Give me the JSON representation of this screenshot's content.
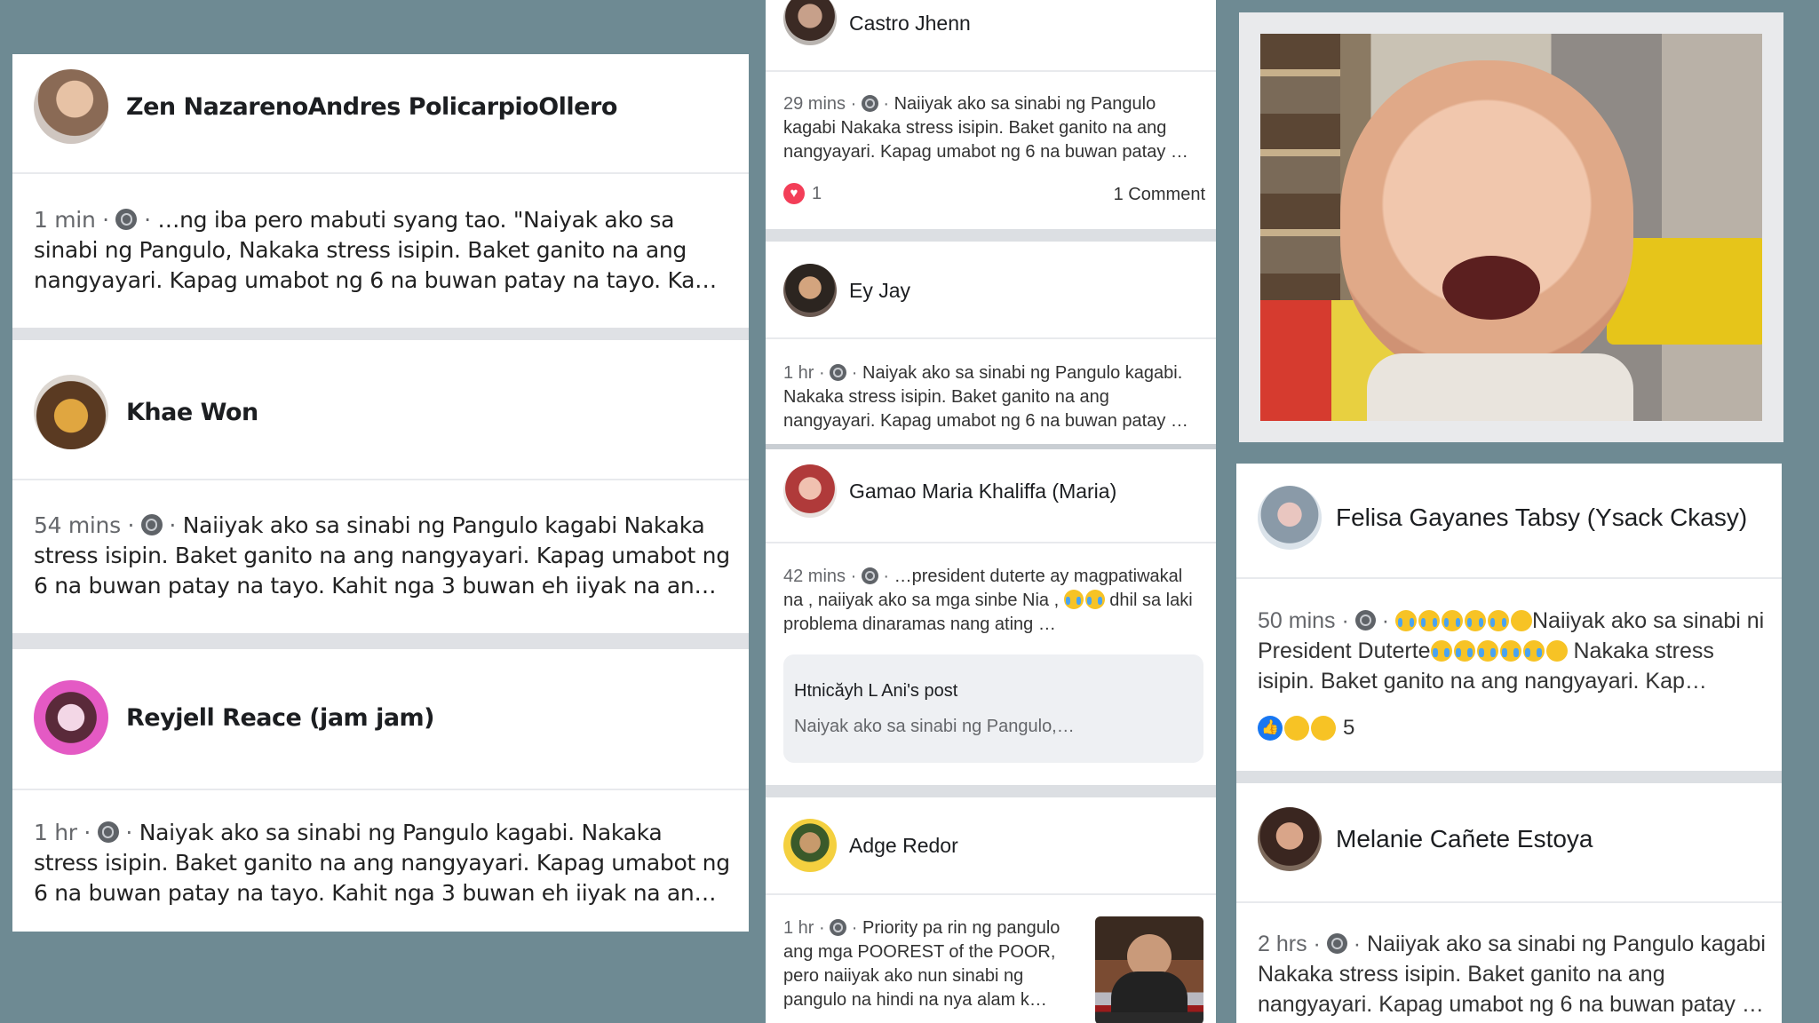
{
  "left": {
    "posts": [
      {
        "author": "Zen NazarenoAndres PolicarpioOllero",
        "time": "1 min",
        "text": "…ng iba pero mabuti syang tao. \"Naiyak ako sa sinabi ng Pangulo, Nakaka stress isipin. Baket ganito na ang nangyayari. Kapag umabot ng 6 na buwan patay na tayo. Ka…"
      },
      {
        "author": "Khae Won",
        "time": "54 mins",
        "text": "Naiiyak ako sa sinabi ng Pangulo kagabi Nakaka stress isipin. Baket ganito na ang nangyayari. Kapag umabot ng 6 na buwan patay na tayo. Kahit nga 3 buwan eh iiyak na an…"
      },
      {
        "author": "Reyjell Reace (jam jam)",
        "time": "1 hr",
        "text": "Naiyak ako sa sinabi ng Pangulo kagabi. Nakaka stress isipin. Baket ganito na ang nangyayari. Kapag umabot ng 6 na buwan patay na tayo. Kahit nga 3 buwan eh iiyak na an…"
      }
    ]
  },
  "middle": {
    "posts": [
      {
        "author": "Castro Jhenn",
        "time": "29 mins",
        "text": "Naiiyak ako sa sinabi ng Pangulo kagabi Nakaka stress isipin. Baket ganito na ang nangyayari. Kapag umabot ng 6 na buwan patay …",
        "reaction_count": "1",
        "comments": "1 Comment"
      },
      {
        "author": "Ey Jay",
        "time": "1 hr",
        "text": "Naiyak ako sa sinabi ng Pangulo kagabi. Nakaka stress isipin. Baket ganito na ang nangyayari. Kapag umabot ng 6 na buwan patay …"
      },
      {
        "author": "Gamao Maria Khaliffa (Maria)",
        "time": "42 mins",
        "text_a": "…president duterte ay magpatiwakal na , naiiyak ako sa mga sinbe Nia ,",
        "text_b": "dhil sa laki problema dinaramas nang ating …",
        "shared_title": "Htnicăyh L Ani's post",
        "shared_preview": "Naiyak ako sa sinabi ng Pangulo,…"
      },
      {
        "author": "Adge Redor",
        "time": "1 hr",
        "text": "Priority pa rin ng pangulo ang mga POOREST of the POOR, pero naiiyak ako nun sinabi ng pangulo na hindi na nya alam k…"
      }
    ]
  },
  "right": {
    "posts": [
      {
        "author": "Felisa Gayanes Tabsy (Ysack Ckasy)",
        "time": "50 mins",
        "text_a": "Naiiyak ako sa sinabi ni President Duterte",
        "text_b": "Nakaka stress isipin. Baket ganito na ang nangyayari. Kap…",
        "reaction_count": "5"
      },
      {
        "author": "Melanie Cañete Estoya",
        "time": "2 hrs",
        "text": "Naiiyak ako sa sinabi ng Pangulo kagabi Nakaka stress isipin. Baket ganito na ang nangyayari. Kapag umabot ng 6 na buwan patay …"
      }
    ]
  },
  "colors": {
    "background": "#6e8a93",
    "card": "#ffffff",
    "meta_text": "#65676b",
    "like_blue": "#1877f2",
    "heart_red": "#f33e58"
  }
}
